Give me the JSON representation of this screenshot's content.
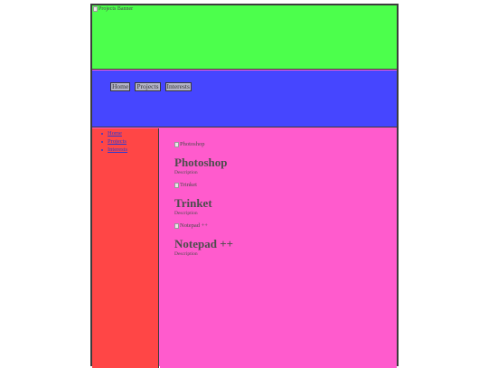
{
  "banner": {
    "image_alt": "Projects Banner"
  },
  "nav": {
    "buttons": [
      {
        "label": "Home"
      },
      {
        "label": "Projects"
      },
      {
        "label": "Interests"
      }
    ]
  },
  "sidebar": {
    "links": [
      {
        "label": "Home"
      },
      {
        "label": "Projects"
      },
      {
        "label": "Interests"
      }
    ]
  },
  "projects": [
    {
      "image_alt": "Photoshop",
      "title": "Photoshop",
      "description": "Description"
    },
    {
      "image_alt": "Trinket",
      "title": "Trinket",
      "description": "Description"
    },
    {
      "image_alt": "Notepad ++",
      "title": "Notepad ++",
      "description": "Description"
    }
  ],
  "colors": {
    "banner": "#4cff4c",
    "navbar": "#4646ff",
    "sidebar": "#ff4646",
    "content": "#ff5bcd",
    "link": "#2c3ad0"
  },
  "icons": {
    "broken_image": "broken-image-icon"
  }
}
